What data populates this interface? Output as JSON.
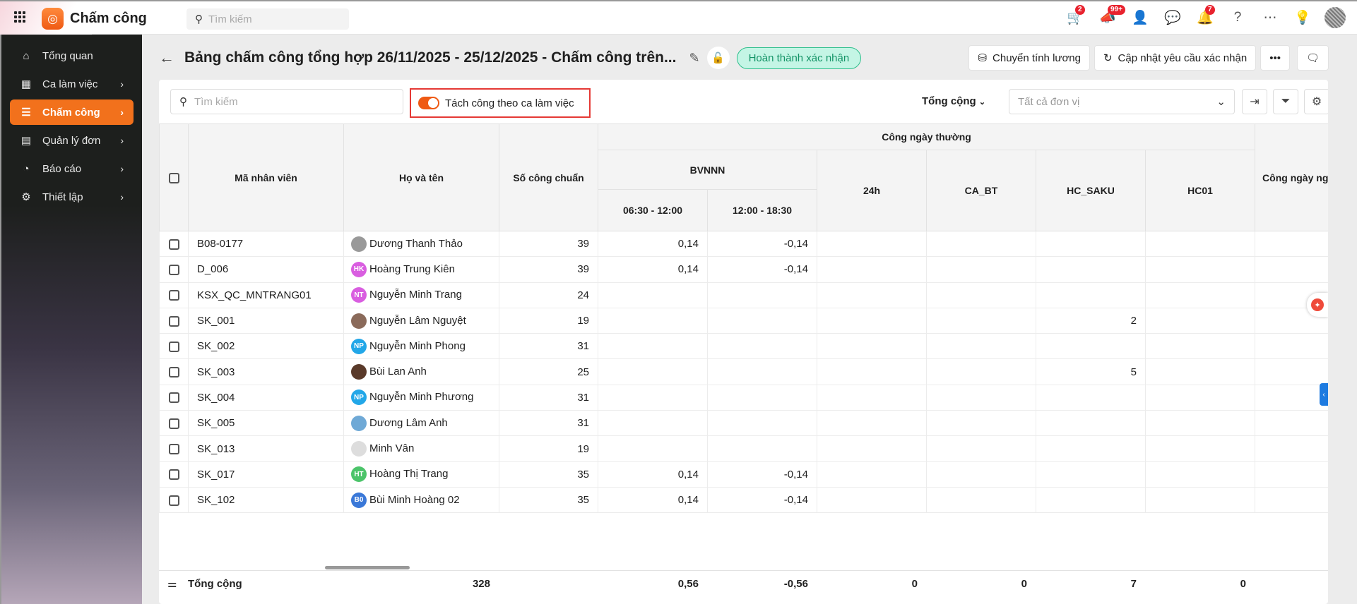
{
  "app": {
    "title": "Chấm công",
    "search_placeholder": "Tìm kiếm"
  },
  "topbar": {
    "badges": {
      "cart": "2",
      "megaphone": "99+",
      "bell": "7"
    }
  },
  "sidebar": {
    "items": [
      {
        "label": "Tổng quan",
        "icon": "⌂",
        "chev": false,
        "active": false
      },
      {
        "label": "Ca làm việc",
        "icon": "▦",
        "chev": true,
        "active": false
      },
      {
        "label": "Chấm công",
        "icon": "☰",
        "chev": true,
        "active": true
      },
      {
        "label": "Quản lý đơn",
        "icon": "▤",
        "chev": true,
        "active": false
      },
      {
        "label": "Báo cáo",
        "icon": "◔",
        "chev": true,
        "active": false
      },
      {
        "label": "Thiết lập",
        "icon": "⚙",
        "chev": true,
        "active": false
      }
    ]
  },
  "header": {
    "title": "Bảng chấm công tổng hợp 26/11/2025 - 25/12/2025 - Chấm công trên...",
    "status": "Hoàn thành xác nhận",
    "btn_transfer": "Chuyển tính lương",
    "btn_update": "Cập nhật yêu cầu xác nhận"
  },
  "toolbar": {
    "search_placeholder": "Tìm kiếm",
    "toggle_label": "Tách công theo ca làm việc",
    "total_label": "Tổng cộng",
    "unit_placeholder": "Tất cả đơn vị"
  },
  "table": {
    "headers": {
      "code": "Mã nhân viên",
      "name": "Họ và tên",
      "std": "Số công chuẩn",
      "group": "Công ngày thường",
      "bvnnn": "BVNNN",
      "s1": "06:30 - 12:00",
      "s2": "12:00 - 18:30",
      "h24": "24h",
      "cabt": "CA_BT",
      "hcsaku": "HC_SAKU",
      "hc01": "HC01",
      "holiday": "Công ngày nghỉ"
    },
    "rows": [
      {
        "code": "B08-0177",
        "name": "Dương Thanh Thảo",
        "initials": "",
        "color": "#999",
        "std": "39",
        "v": [
          "0,14",
          "-0,14",
          "",
          "",
          "",
          ""
        ]
      },
      {
        "code": "D_006",
        "name": "Hoàng Trung Kiên",
        "initials": "HK",
        "color": "#d95ee0",
        "std": "39",
        "v": [
          "0,14",
          "-0,14",
          "",
          "",
          "",
          ""
        ]
      },
      {
        "code": "KSX_QC_MNTRANG01",
        "name": "Nguyễn Minh Trang",
        "initials": "NT",
        "color": "#d95ee0",
        "std": "24",
        "v": [
          "",
          "",
          "",
          "",
          "",
          ""
        ]
      },
      {
        "code": "SK_001",
        "name": "Nguyễn Lâm Nguyệt",
        "initials": "",
        "color": "#8a6a5a",
        "std": "19",
        "v": [
          "",
          "",
          "",
          "",
          "2",
          ""
        ]
      },
      {
        "code": "SK_002",
        "name": "Nguyễn Minh Phong",
        "initials": "NP",
        "color": "#22a7e8",
        "std": "31",
        "v": [
          "",
          "",
          "",
          "",
          "",
          ""
        ]
      },
      {
        "code": "SK_003",
        "name": "Bùi Lan Anh",
        "initials": "",
        "color": "#5a3a2a",
        "std": "25",
        "v": [
          "",
          "",
          "",
          "",
          "5",
          ""
        ]
      },
      {
        "code": "SK_004",
        "name": "Nguyễn Minh Phương",
        "initials": "NP",
        "color": "#22a7e8",
        "std": "31",
        "v": [
          "",
          "",
          "",
          "",
          "",
          ""
        ]
      },
      {
        "code": "SK_005",
        "name": "Dương Lâm Anh",
        "initials": "",
        "color": "#6fa9d6",
        "std": "31",
        "v": [
          "",
          "",
          "",
          "",
          "",
          ""
        ]
      },
      {
        "code": "SK_013",
        "name": "Minh Vân",
        "initials": "",
        "color": "#ddd",
        "std": "19",
        "v": [
          "",
          "",
          "",
          "",
          "",
          ""
        ]
      },
      {
        "code": "SK_017",
        "name": "Hoàng Thị Trang",
        "initials": "HT",
        "color": "#4cc46a",
        "std": "35",
        "v": [
          "0,14",
          "-0,14",
          "",
          "",
          "",
          ""
        ]
      },
      {
        "code": "SK_102",
        "name": "Bùi Minh Hoàng 02",
        "initials": "B0",
        "color": "#3a78d8",
        "std": "35",
        "v": [
          "0,14",
          "-0,14",
          "",
          "",
          "",
          ""
        ]
      }
    ],
    "footer": {
      "label": "Tổng cộng",
      "values": [
        "328",
        "0,56",
        "-0,56",
        "0",
        "0",
        "7",
        "0"
      ]
    }
  }
}
